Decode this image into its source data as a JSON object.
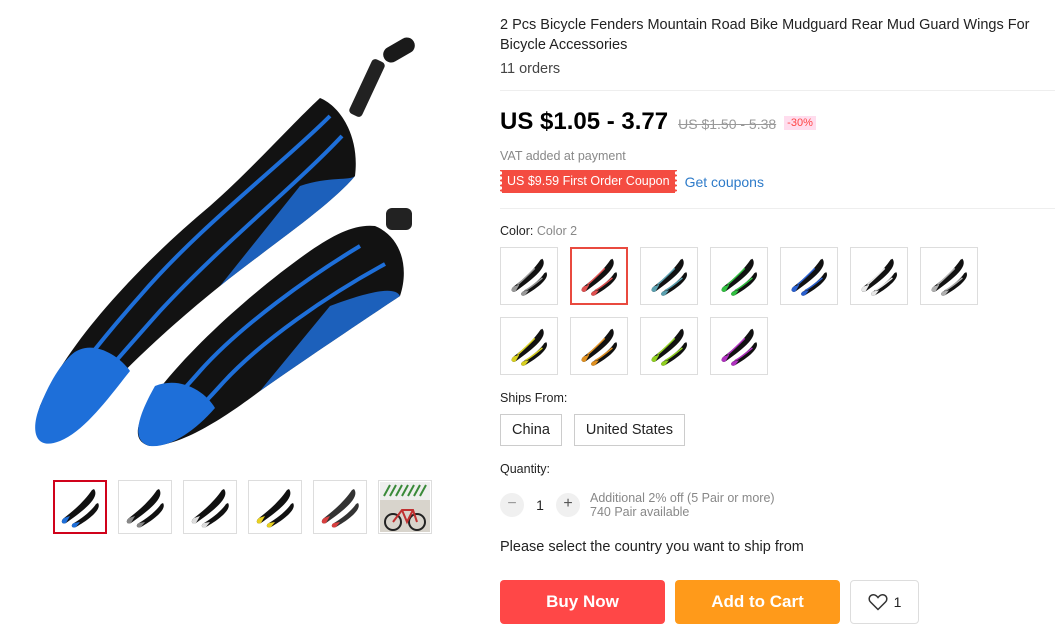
{
  "product": {
    "title": "2 Pcs Bicycle Fenders Mountain Road Bike Mudguard Rear Mud Guard Wings For Bicycle Accessories",
    "orders": "11 orders",
    "price": "US $1.05 - 3.77",
    "original_price": "US $1.50 - 5.38",
    "discount": "-30%",
    "vat_note": "VAT added at payment",
    "coupon": "US $9.59 First Order Coupon",
    "get_coupons": "Get coupons"
  },
  "gallery": {
    "main_image": "blue-fender-pair",
    "thumbs": [
      {
        "icon": "fender-blue-icon",
        "accent": "#1e6fd9"
      },
      {
        "icon": "fender-gray-icon",
        "accent": "#888888"
      },
      {
        "icon": "fender-white-icon",
        "accent": "#e0e0e0"
      },
      {
        "icon": "fender-yellow-icon",
        "accent": "#e8d020"
      },
      {
        "icon": "fender-red-icon",
        "accent": "#d84040"
      },
      {
        "icon": "bicycle-photo-icon",
        "accent": "#c03030"
      }
    ]
  },
  "color": {
    "label": "Color:",
    "selected": "Color 2",
    "swatches": [
      {
        "accent": "#999999"
      },
      {
        "accent": "#e05050"
      },
      {
        "accent": "#5aa0b0"
      },
      {
        "accent": "#30c040"
      },
      {
        "accent": "#2a60d0"
      },
      {
        "accent": "#e8e8e8"
      },
      {
        "accent": "#b0b0b0"
      },
      {
        "accent": "#d8d020"
      },
      {
        "accent": "#e09020"
      },
      {
        "accent": "#90d020"
      },
      {
        "accent": "#b030c0"
      }
    ]
  },
  "ships_from": {
    "label": "Ships From:",
    "options": [
      "China",
      "United States"
    ]
  },
  "quantity": {
    "label": "Quantity:",
    "value": "1",
    "minus": "−",
    "plus": "+",
    "discount_note": "Additional 2% off (5 Pair or more)",
    "available": "740 Pair available"
  },
  "ship_message": "Please select the country you want to ship from",
  "actions": {
    "buy_now": "Buy Now",
    "add_to_cart": "Add to Cart",
    "wishlist_count": "1"
  }
}
